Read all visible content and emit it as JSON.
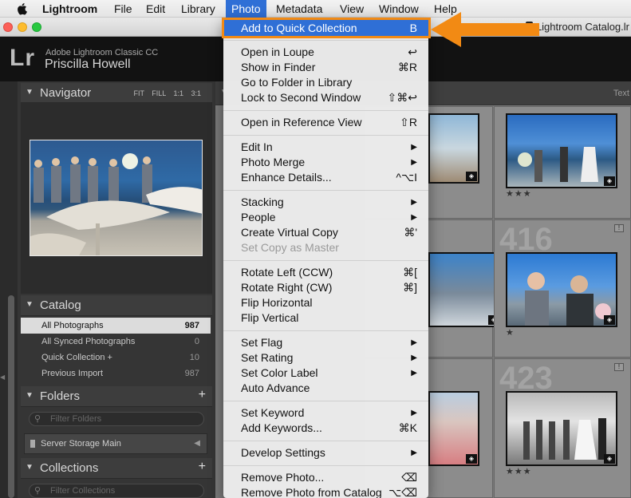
{
  "menubar": {
    "apple": "",
    "items": [
      {
        "label": "Lightroom",
        "bold": true
      },
      {
        "label": "File"
      },
      {
        "label": "Edit"
      },
      {
        "label": "Library"
      },
      {
        "label": "Photo",
        "active": true
      },
      {
        "label": "Metadata"
      },
      {
        "label": "View"
      },
      {
        "label": "Window"
      },
      {
        "label": "Help"
      }
    ]
  },
  "window": {
    "title": "Lightroom Catalog.lr"
  },
  "identity": {
    "logo": "Lr",
    "app": "Adobe Lightroom Classic CC",
    "user": "Priscilla Howell"
  },
  "navigator": {
    "title": "Navigator",
    "modes": "FIT FILL 1:1 3:1"
  },
  "catalog": {
    "title": "Catalog",
    "items": [
      {
        "label": "All Photographs",
        "count": "987",
        "selected": true
      },
      {
        "label": "All Synced Photographs",
        "count": "0"
      },
      {
        "label": "Quick Collection +",
        "count": "10"
      },
      {
        "label": "Previous Import",
        "count": "987"
      }
    ]
  },
  "folders": {
    "title": "Folders",
    "filter_placeholder": "Filter Folders",
    "server": "Server Storage Main"
  },
  "collections": {
    "title": "Collections",
    "filter_placeholder": "Filter Collections"
  },
  "grid": {
    "toolbar_text": "Text",
    "cells": [
      {
        "number": "",
        "stars": "★★★"
      },
      {
        "number": "416",
        "stars": "★"
      },
      {
        "number": "423",
        "stars": "★★★"
      }
    ]
  },
  "photo_menu": {
    "items": [
      {
        "label": "Add to Quick Collection",
        "shortcut": "B",
        "highlighted": true
      },
      {
        "label": "Open in Loupe",
        "shortcut": "↩"
      },
      {
        "label": "Show in Finder",
        "shortcut": "⌘R"
      },
      {
        "label": "Go to Folder in Library",
        "shortcut": ""
      },
      {
        "label": "Lock to Second Window",
        "shortcut": "⇧⌘↩"
      },
      {
        "label": "Open in Reference View",
        "shortcut": "⇧R"
      },
      {
        "label": "Edit In",
        "submenu": true
      },
      {
        "label": "Photo Merge",
        "submenu": true
      },
      {
        "label": "Enhance Details...",
        "shortcut": "^⌥I"
      },
      {
        "label": "Stacking",
        "submenu": true
      },
      {
        "label": "People",
        "submenu": true
      },
      {
        "label": "Create Virtual Copy",
        "shortcut": "⌘'"
      },
      {
        "label": "Set Copy as Master",
        "disabled": true
      },
      {
        "label": "Rotate Left (CCW)",
        "shortcut": "⌘["
      },
      {
        "label": "Rotate Right (CW)",
        "shortcut": "⌘]"
      },
      {
        "label": "Flip Horizontal",
        "shortcut": ""
      },
      {
        "label": "Flip Vertical",
        "shortcut": ""
      },
      {
        "label": "Set Flag",
        "submenu": true
      },
      {
        "label": "Set Rating",
        "submenu": true
      },
      {
        "label": "Set Color Label",
        "submenu": true
      },
      {
        "label": "Auto Advance",
        "shortcut": ""
      },
      {
        "label": "Set Keyword",
        "submenu": true
      },
      {
        "label": "Add Keywords...",
        "shortcut": "⌘K"
      },
      {
        "label": "Develop Settings",
        "submenu": true
      },
      {
        "label": "Remove Photo...",
        "shortcut": "⌫"
      },
      {
        "label": "Remove Photo from Catalog",
        "shortcut": "⌥⌫"
      }
    ]
  },
  "colors": {
    "accent": "#2f6fd6",
    "annotation": "#f28a14"
  }
}
